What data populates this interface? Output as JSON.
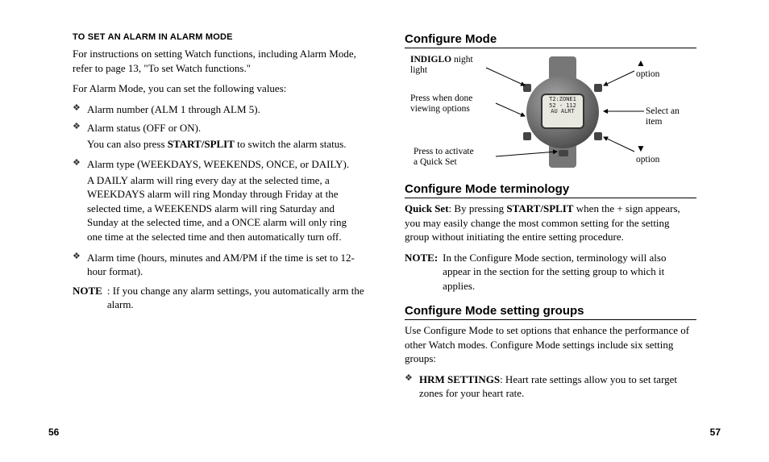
{
  "left": {
    "subhead": "TO SET AN ALARM IN ALARM MODE",
    "intro": "For instructions on setting Watch functions, including Alarm Mode, refer to page 13, \"To set Watch functions.\"",
    "lead": "For Alarm Mode, you can set the following values:",
    "items": {
      "i0": "Alarm number (ALM 1 through ALM 5).",
      "i1": "Alarm status (OFF or ON).",
      "i1_sub_pre": "You can also press ",
      "i1_sub_bold": "START/SPLIT",
      "i1_sub_post": " to switch the alarm status.",
      "i2": "Alarm type (WEEKDAYS, WEEKENDS, ONCE, or DAILY).",
      "i2_sub": "A DAILY alarm will ring every day at the selected time, a WEEKDAYS alarm will ring Monday through Friday at the selected time, a WEEKENDS alarm will ring Saturday and Sunday at the selected time, and a ONCE alarm will only ring one time at the selected time and then automatically turn off.",
      "i3": "Alarm time (hours, minutes and AM/PM if the time is set to 12-hour format)."
    },
    "note_label": "NOTE",
    "note_text": ":  If you change any alarm settings, you automatically arm the alarm.",
    "pagenum": "56"
  },
  "right": {
    "h_configure": "Configure Mode",
    "diagram": {
      "indiglo_bold": "INDIGLO",
      "indiglo_rest": " night\nlight",
      "press_done": "Press when done\nviewing options",
      "press_quick": "Press to activate\na Quick Set",
      "up_tri": "▲",
      "up_label": "option",
      "select": "Select an item",
      "down_tri": "▼",
      "down_label": "option",
      "face_l1": "T2:ZONE1",
      "face_l2": "52 - 112",
      "face_l3": "AU ALRT"
    },
    "h_term": "Configure Mode terminology",
    "term_bold1": "Quick Set",
    "term_mid": ": By pressing ",
    "term_bold2": "START/SPLIT",
    "term_rest": " when the + sign appears, you may easily change the most common setting for the setting group without initiating the entire setting procedure.",
    "note_label": "NOTE:",
    "note_text": " In the Configure Mode section, terminology will also appear in the section for the setting group to which it applies.",
    "h_groups": "Configure Mode setting groups",
    "groups_intro": "Use Configure Mode to set options that enhance the performance of other Watch modes. Configure Mode settings include six setting groups:",
    "group0_bold": "HRM SETTINGS",
    "group0_rest": ": Heart rate settings allow you to set target zones for your heart rate.",
    "pagenum": "57"
  }
}
